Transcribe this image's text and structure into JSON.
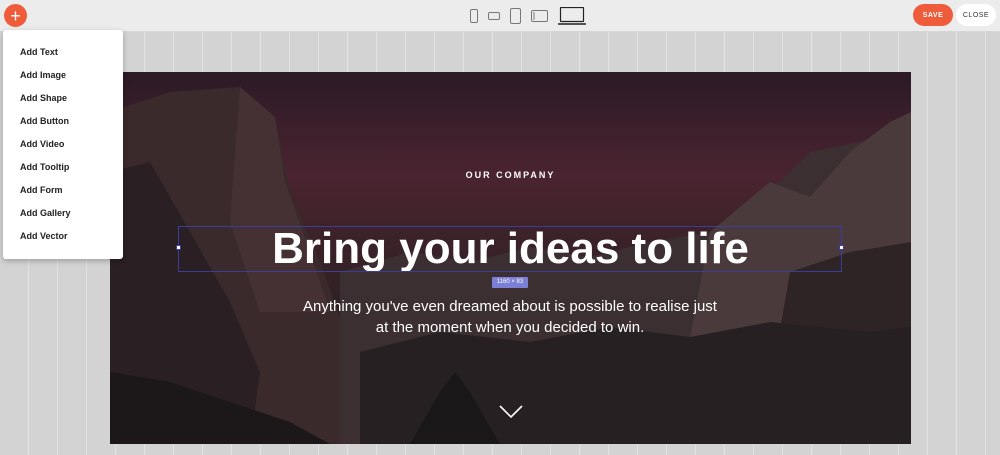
{
  "toolbar": {
    "add_icon": "plus-icon",
    "devices": [
      {
        "name": "mobile-portrait",
        "icon": "phone-portrait-icon"
      },
      {
        "name": "mobile-landscape",
        "icon": "phone-landscape-icon"
      },
      {
        "name": "tablet-portrait",
        "icon": "tablet-portrait-icon"
      },
      {
        "name": "tablet-landscape",
        "icon": "tablet-landscape-icon"
      },
      {
        "name": "desktop",
        "icon": "laptop-icon",
        "active": true
      }
    ],
    "save_label": "SAVE",
    "close_label": "CLOSE"
  },
  "add_menu": {
    "items": [
      "Add Text",
      "Add Image",
      "Add Shape",
      "Add Button",
      "Add Video",
      "Add Tooltip",
      "Add Form",
      "Add Gallery",
      "Add Vector"
    ]
  },
  "hero": {
    "eyebrow": "OUR COMPANY",
    "headline": "Bring your ideas to life",
    "selection_size": "1160 × 83",
    "subtext": "Anything you've even dreamed about is possible to realise just at the moment when you decided to win.",
    "scroll_icon": "chevron-down-icon"
  },
  "colors": {
    "accent": "#ef5c3b",
    "selection": "#3b3d9c",
    "badge": "#7c7fd6",
    "workspace": "#d3d3d3"
  }
}
